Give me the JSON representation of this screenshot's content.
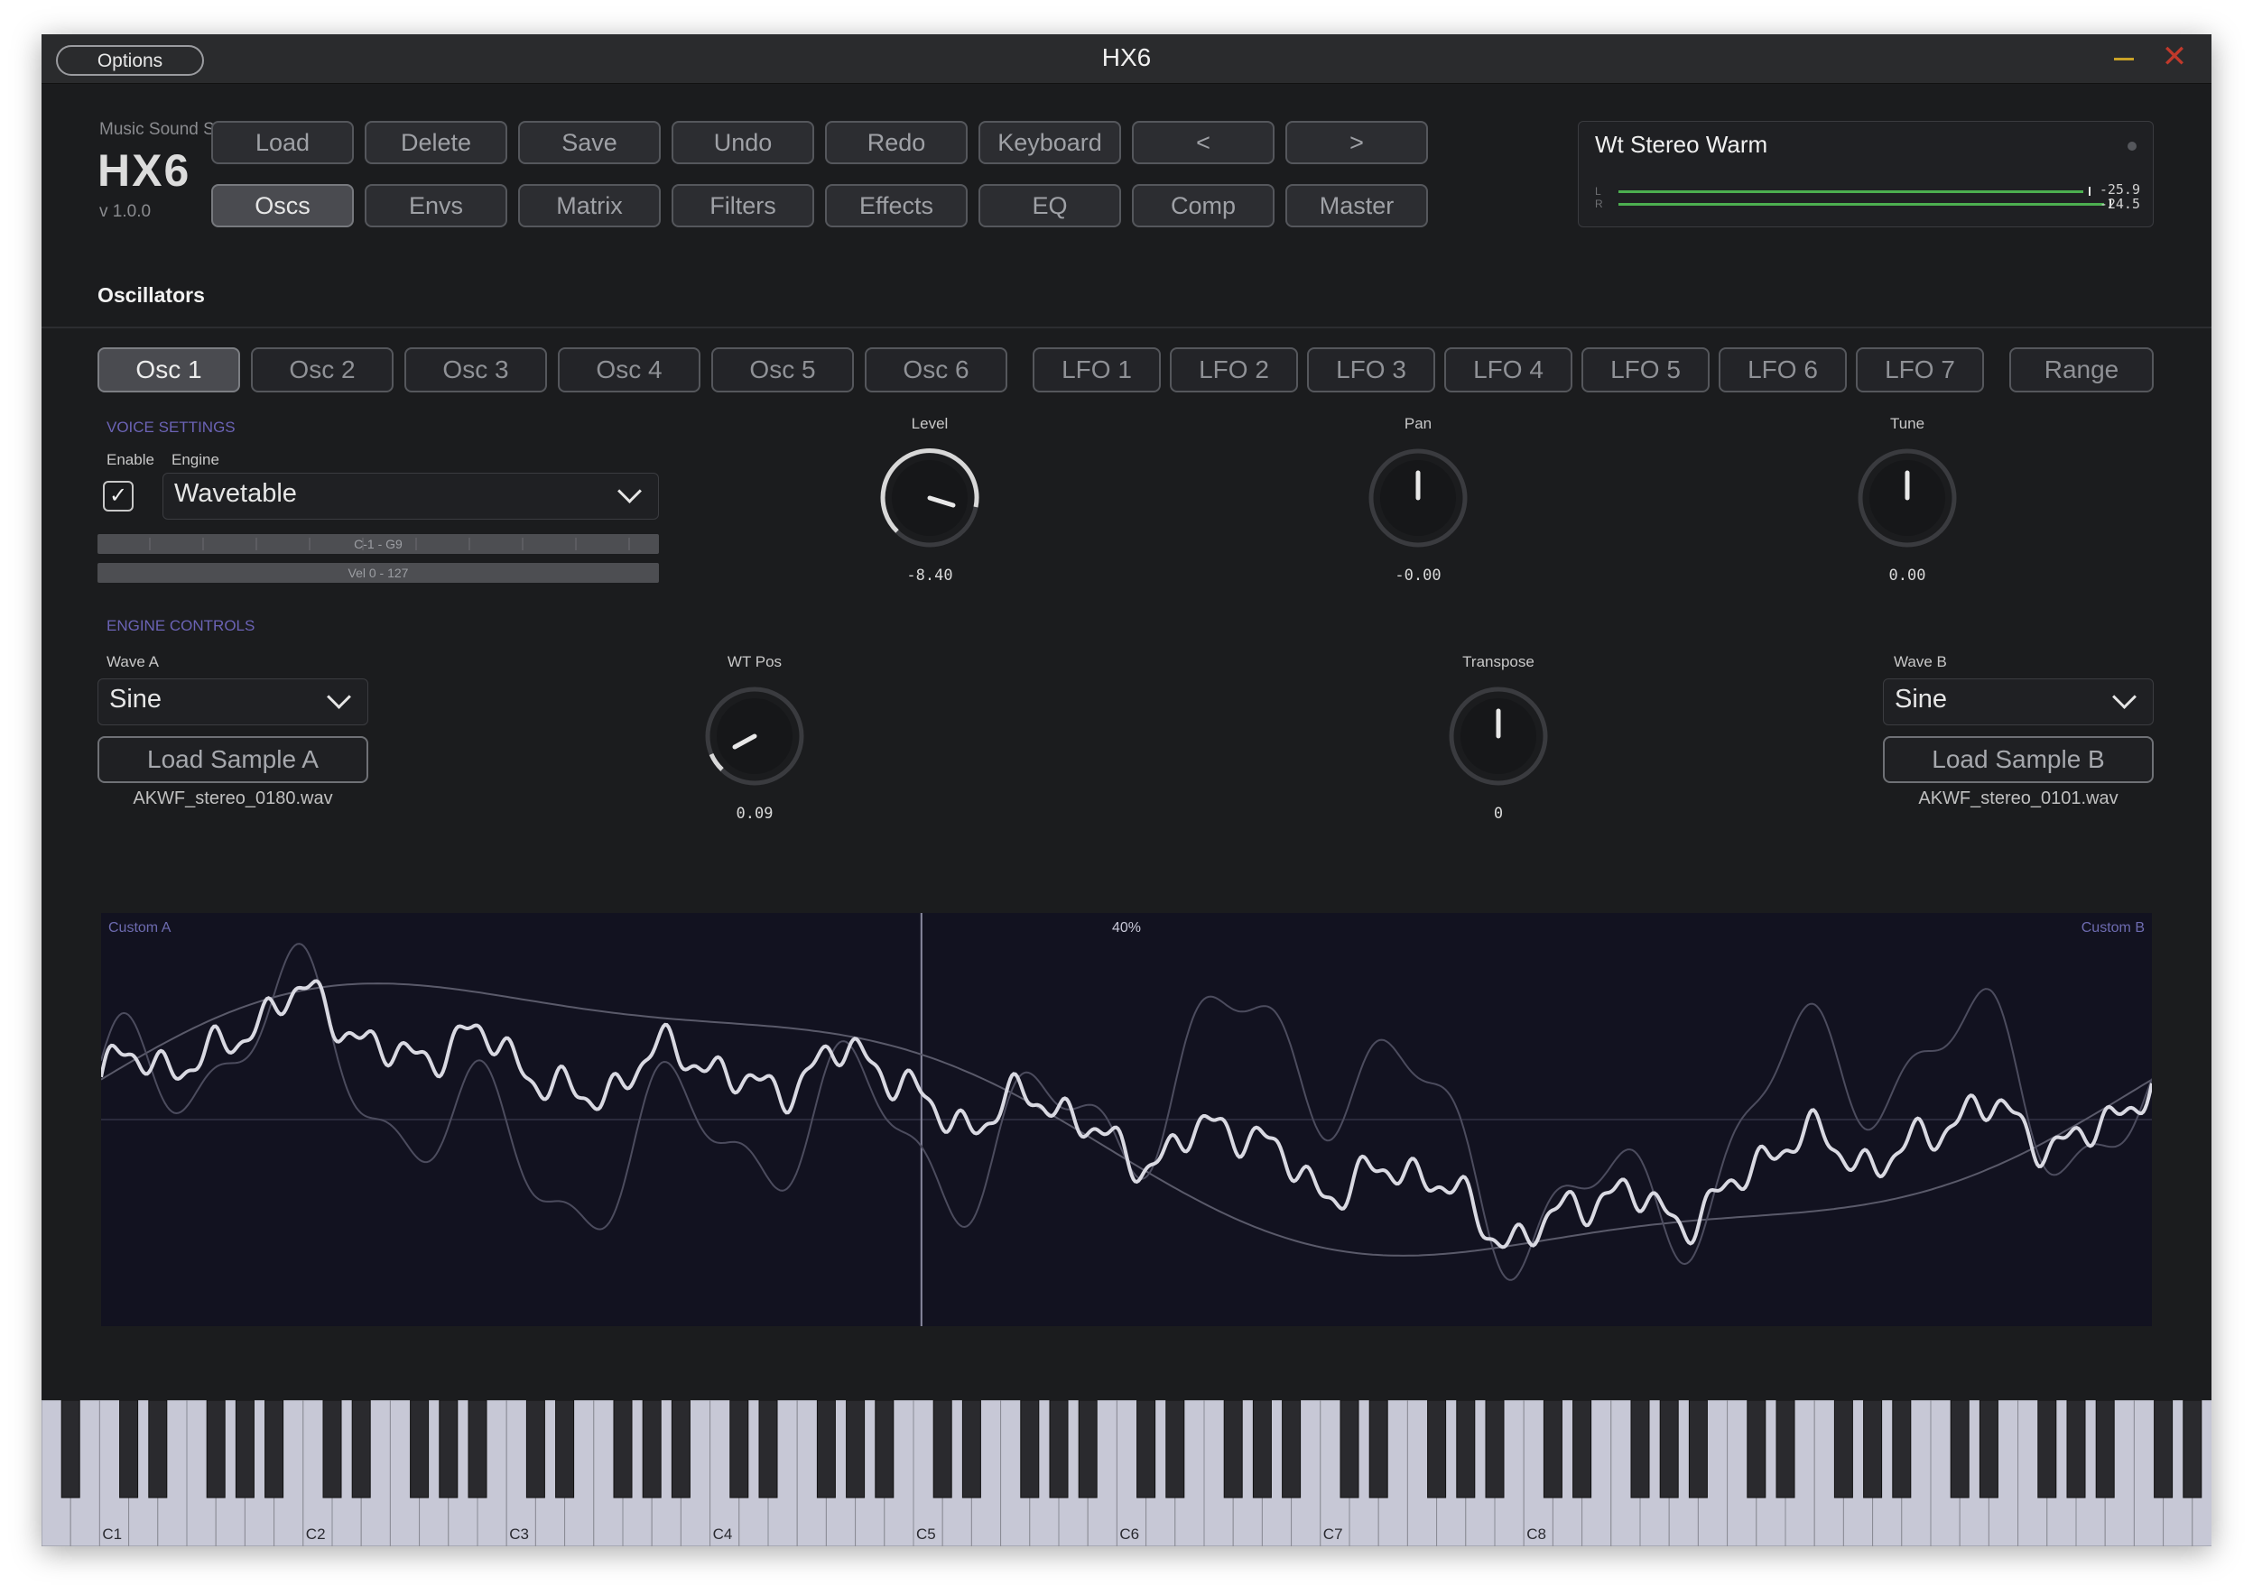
{
  "window": {
    "title": "HX6",
    "options_label": "Options"
  },
  "brand": {
    "company": "Music Sound Software",
    "logo": "HX6",
    "version": "v 1.0.0"
  },
  "toolbar_row1": [
    "Load",
    "Delete",
    "Save",
    "Undo",
    "Redo",
    "Keyboard",
    "<",
    ">"
  ],
  "toolbar_row2": [
    "Oscs",
    "Envs",
    "Matrix",
    "Filters",
    "Effects",
    "EQ",
    "Comp",
    "Master"
  ],
  "toolbar_active": "Oscs",
  "preset": {
    "name": "Wt Stereo Warm",
    "meter": {
      "l_label": "L",
      "r_label": "R",
      "l_value": "-25.9",
      "r_value": "-24.5",
      "l_fraction": 0.92,
      "r_fraction": 0.96
    },
    "meter_color": "#4caf50"
  },
  "section_title": "Oscillators",
  "osc_tabs": [
    "Osc 1",
    "Osc 2",
    "Osc 3",
    "Osc 4",
    "Osc 5",
    "Osc 6"
  ],
  "lfo_tabs": [
    "LFO 1",
    "LFO 2",
    "LFO 3",
    "LFO 4",
    "LFO 5",
    "LFO 6",
    "LFO 7"
  ],
  "range_tab": "Range",
  "active_tab": "Osc 1",
  "voice": {
    "heading": "VOICE SETTINGS",
    "enable_label": "Enable",
    "engine_label": "Engine",
    "enabled": true,
    "engine_value": "Wavetable",
    "key_range": "C-1 - G9",
    "vel_range": "Vel 0 - 127"
  },
  "knobs": {
    "level": {
      "label": "Level",
      "value": "-8.40"
    },
    "pan": {
      "label": "Pan",
      "value": "-0.00"
    },
    "tune": {
      "label": "Tune",
      "value": "0.00"
    },
    "wtpos": {
      "label": "WT Pos",
      "value": "0.09"
    },
    "transpose": {
      "label": "Transpose",
      "value": "0"
    }
  },
  "engine": {
    "heading": "ENGINE CONTROLS",
    "wave_a_label": "Wave A",
    "wave_a_value": "Sine",
    "load_a_label": "Load Sample A",
    "sample_a": "AKWF_stereo_0180.wav",
    "wave_b_label": "Wave B",
    "wave_b_value": "Sine",
    "load_b_label": "Load Sample B",
    "sample_b": "AKWF_stereo_0101.wav"
  },
  "waveform": {
    "left_label": "Custom A",
    "right_label": "Custom B",
    "position_label": "40%",
    "position": 0.4
  },
  "keyboard": {
    "octave_labels": [
      "C1",
      "C2",
      "C3",
      "C4",
      "C5",
      "C6",
      "C7",
      "C8"
    ]
  },
  "colors": {
    "accent": "#6b63b5",
    "background": "#1b1c1e",
    "wave_bg": "#121220"
  }
}
